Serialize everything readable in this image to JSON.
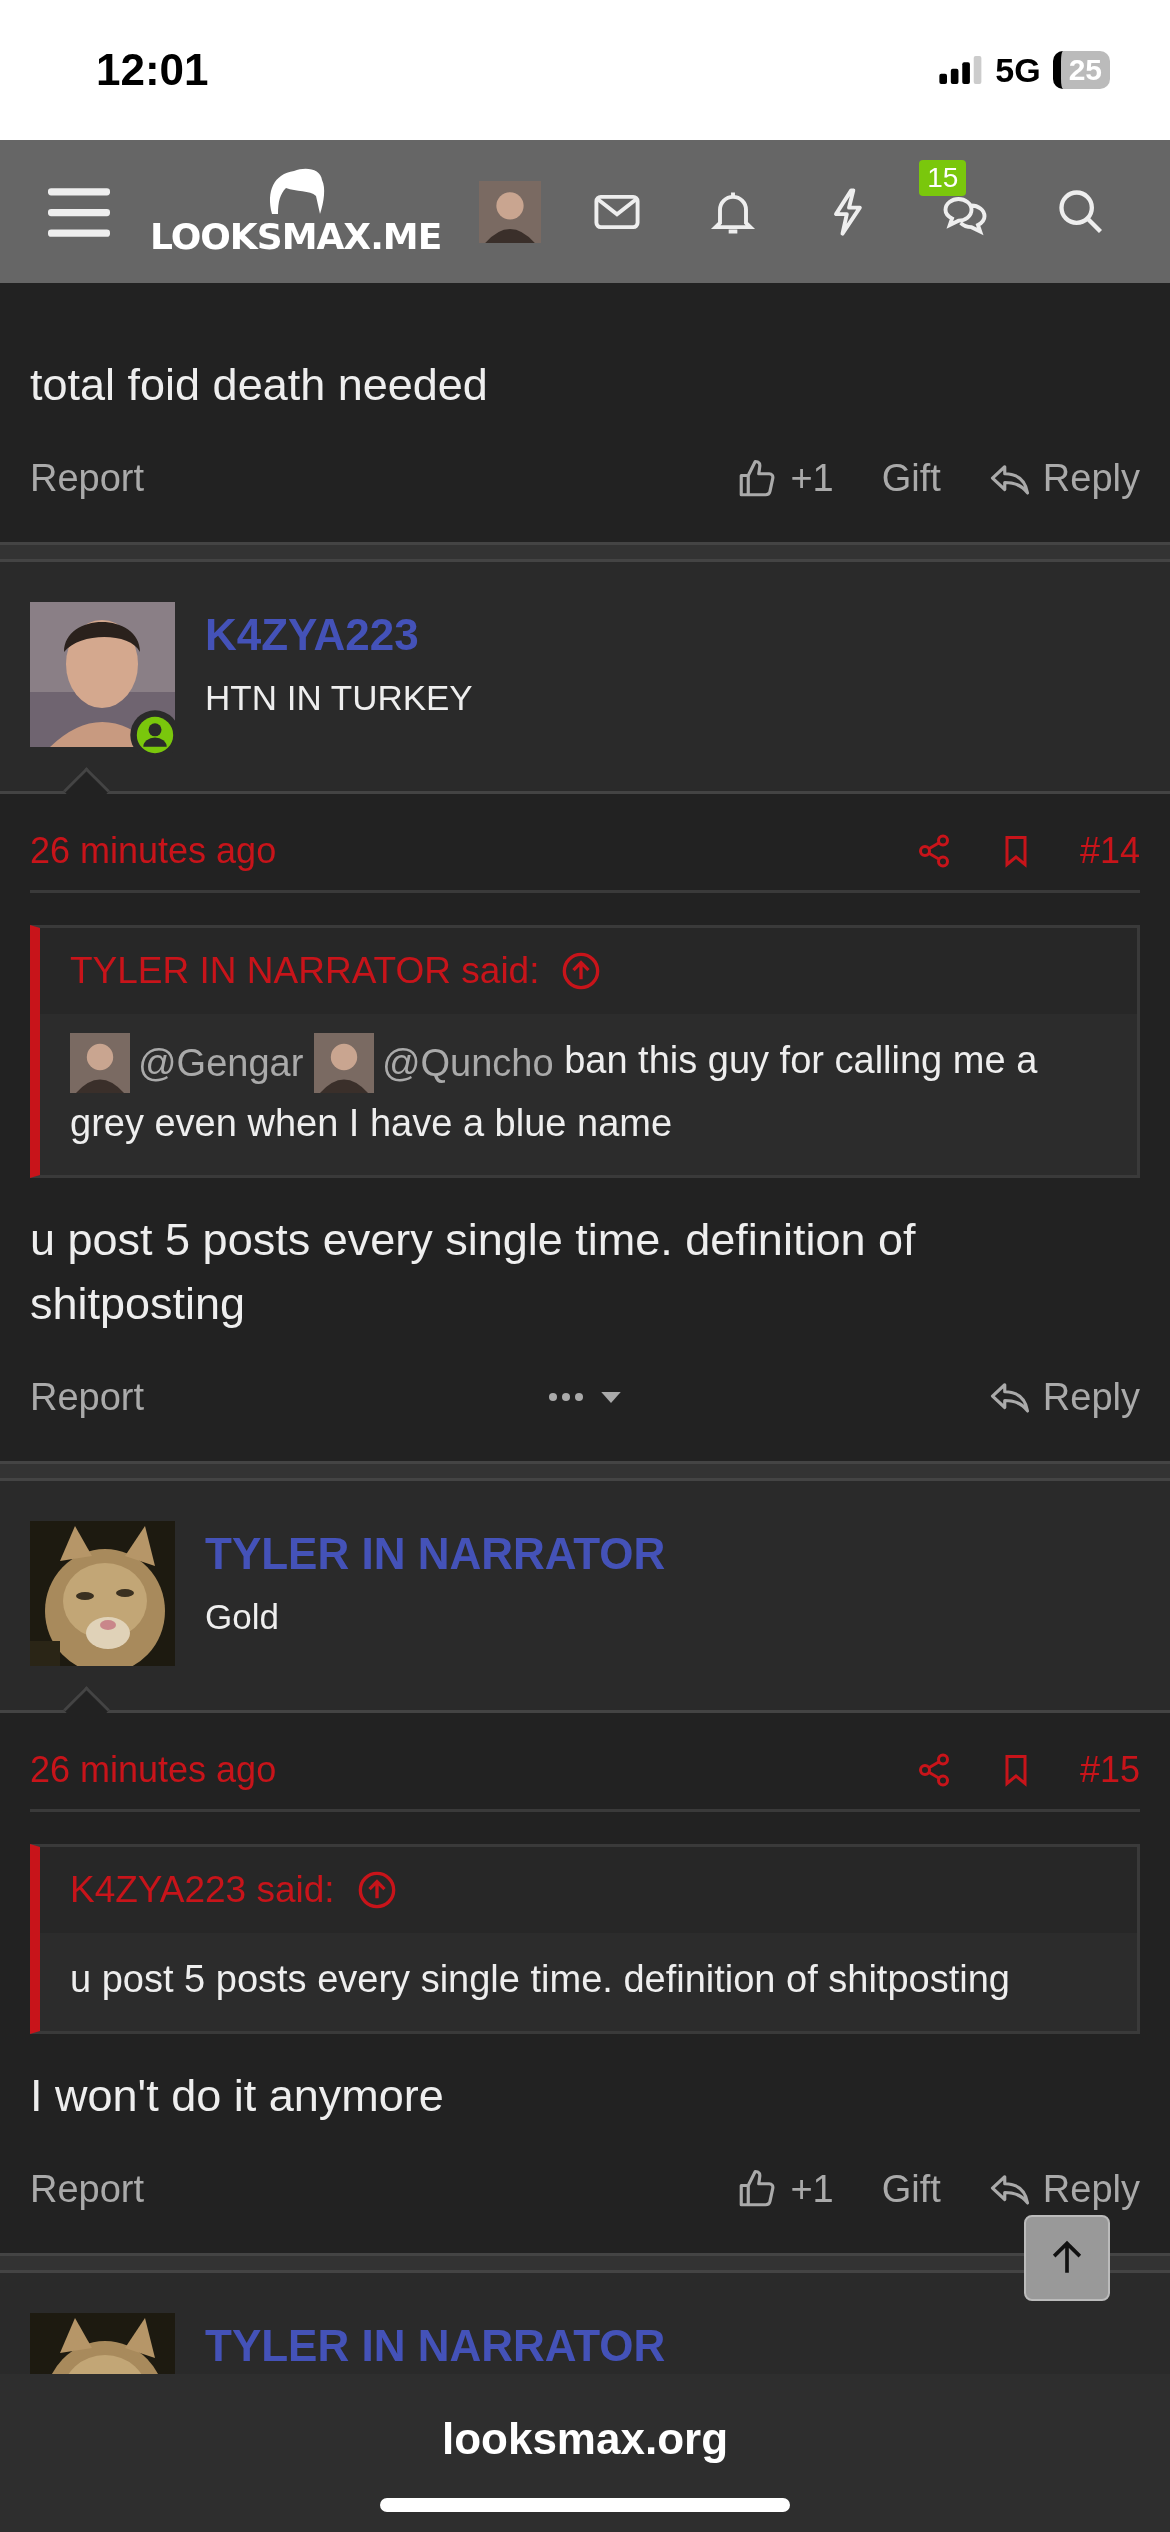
{
  "status_bar": {
    "time": "12:01",
    "network": "5G",
    "battery": "25"
  },
  "nav": {
    "logo": "LOOKSMAX.ME",
    "conversations_badge": "15"
  },
  "posts": [
    {
      "body": "total foid death needed",
      "actions": [
        {
          "kind": "report",
          "label": "Report"
        },
        {
          "kind": "like",
          "label": "+1"
        },
        {
          "kind": "gift",
          "label": "Gift"
        },
        {
          "kind": "reply",
          "label": "Reply"
        }
      ]
    },
    {
      "user": {
        "name": "K4ZYA223",
        "title": "HTN IN TURKEY",
        "online": true
      },
      "time": "26 minutes ago",
      "number": "#14",
      "quote": {
        "author": "TYLER IN NARRATOR said:",
        "parts": [
          {
            "kind": "mention",
            "text": "@Gengar"
          },
          {
            "kind": "mention",
            "text": "@Quncho"
          },
          {
            "kind": "text",
            "text": "ban this guy for calling me a grey even when I have a blue name"
          }
        ]
      },
      "body": "u post 5 posts every single time. definition of shitposting",
      "actions": [
        {
          "kind": "report",
          "label": "Report"
        },
        {
          "kind": "more"
        },
        {
          "kind": "reply",
          "label": "Reply"
        }
      ]
    },
    {
      "user": {
        "name": "TYLER IN NARRATOR",
        "title": "Gold",
        "online": false
      },
      "time": "26 minutes ago",
      "number": "#15",
      "quote": {
        "author": "K4ZYA223 said:",
        "parts": [
          {
            "kind": "text",
            "text": "u post 5 posts every single time. definition of shitposting"
          }
        ]
      },
      "body": "I won't do it anymore",
      "actions": [
        {
          "kind": "report",
          "label": "Report"
        },
        {
          "kind": "like",
          "label": "+1"
        },
        {
          "kind": "gift",
          "label": "Gift"
        },
        {
          "kind": "reply",
          "label": "Reply"
        }
      ]
    },
    {
      "user": {
        "name": "TYLER IN NARRATOR"
      }
    }
  ],
  "url_bar": {
    "address": "looksmax.org"
  }
}
